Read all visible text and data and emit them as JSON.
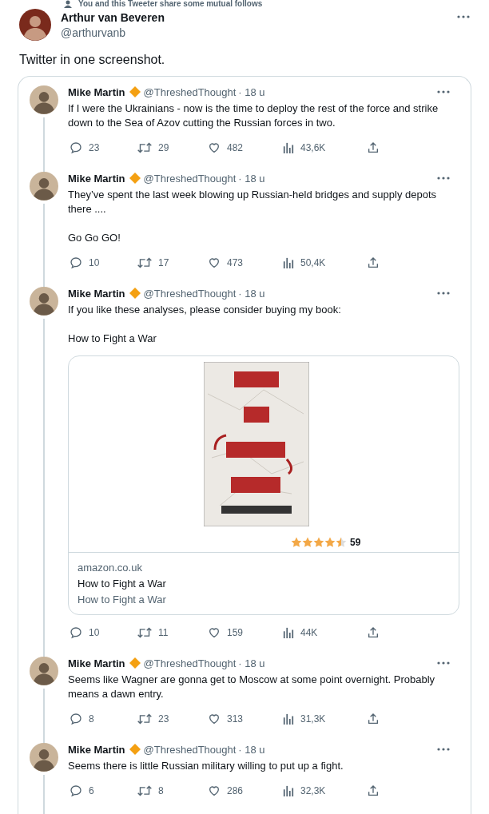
{
  "context_line": "You and this Tweeter share some mutual follows",
  "tweet": {
    "name": "Arthur van Beveren",
    "handle": "@arthurvanb",
    "text": "Twitter in one screenshot."
  },
  "quoted_thread": [
    {
      "name": "Mike Martin",
      "verified": true,
      "handle": "@ThreshedThought",
      "time": "· 18 u",
      "paragraphs": [
        "If I were the Ukrainians - now is the time to deploy the rest of the force and strike down to the Sea of Azov cutting the Russian forces in two."
      ],
      "stats": {
        "replies": "23",
        "retweets": "29",
        "likes": "482",
        "views": "43,6K"
      }
    },
    {
      "name": "Mike Martin",
      "verified": true,
      "handle": "@ThreshedThought",
      "time": "· 18 u",
      "paragraphs": [
        "They’ve spent the last week blowing up Russian-held bridges and supply depots there ....",
        "Go Go GO!"
      ],
      "stats": {
        "replies": "10",
        "retweets": "17",
        "likes": "473",
        "views": "50,4K"
      }
    },
    {
      "name": "Mike Martin",
      "verified": true,
      "handle": "@ThreshedThought",
      "time": "· 18 u",
      "paragraphs": [
        "If you like these analyses, please consider buying my book:",
        "How to Fight a War"
      ],
      "card": {
        "kind": "picture",
        "stars": 4.5,
        "rating_count": "59",
        "domain": "amazon.co.uk",
        "title": "How to Fight a War",
        "description": "How to Fight a War"
      },
      "stats": {
        "replies": "10",
        "retweets": "11",
        "likes": "159",
        "views": "44K"
      }
    },
    {
      "name": "Mike Martin",
      "verified": true,
      "handle": "@ThreshedThought",
      "time": "· 18 u",
      "paragraphs": [
        "Seems like Wagner are gonna get to Moscow at some point overnight. Probably means a dawn entry."
      ],
      "stats": {
        "replies": "8",
        "retweets": "23",
        "likes": "313",
        "views": "31,3K"
      }
    },
    {
      "name": "Mike Martin",
      "verified": true,
      "handle": "@ThreshedThought",
      "time": "· 18 u",
      "paragraphs": [
        "Seems there is little Russian military willing to put up a fight."
      ],
      "stats": {
        "replies": "6",
        "retweets": "8",
        "likes": "286",
        "views": "32,3K"
      }
    }
  ]
}
